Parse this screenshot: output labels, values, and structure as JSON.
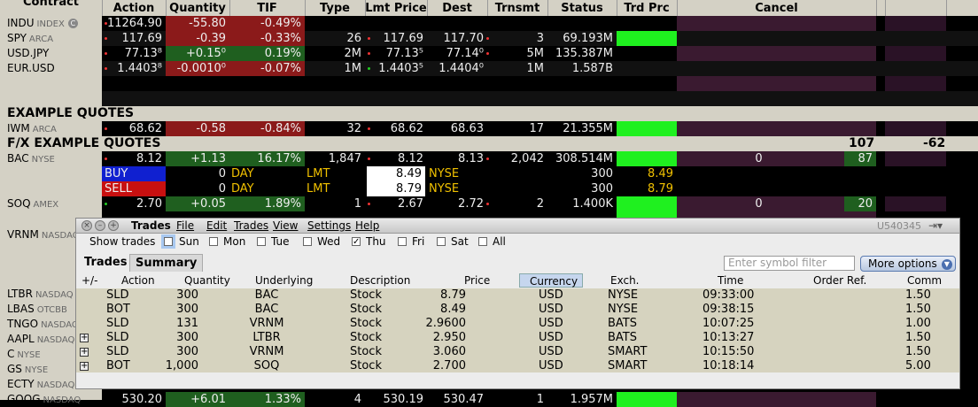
{
  "header": {
    "contract": "Contract",
    "action": "Action",
    "quantity": "Quantity",
    "tif": "TIF",
    "type": "Type",
    "lmt_price": "Lmt Price",
    "dest": "Dest",
    "trnsmt": "Trnsmt",
    "status": "Status",
    "trd_prc": "Trd Prc",
    "cancel": "Cancel"
  },
  "quotes": [
    {
      "sym": "INDU",
      "exch": "INDEX",
      "last": "11264.90",
      "chg": "-55.80",
      "pct": "-0.49%",
      "size": "",
      "bid": "",
      "ask": "",
      "asksize": "",
      "vol": ""
    },
    {
      "sym": "SPY",
      "exch": "ARCA",
      "last": "117.69",
      "chg": "-0.39",
      "pct": "-0.33%",
      "size": "26",
      "bid": "117.69",
      "ask": "117.70",
      "asksize": "3",
      "vol": "69.193M"
    },
    {
      "sym": "USD.JPY",
      "exch": "",
      "last": "77.13⁸",
      "chg": "+0.15⁰",
      "pct": "0.19%",
      "size": "2M",
      "bid": "77.13⁵",
      "ask": "77.14⁰",
      "asksize": "5M",
      "vol": "135.387M"
    },
    {
      "sym": "EUR.USD",
      "exch": "",
      "last": "1.4403⁸",
      "chg": "-0.0010⁰",
      "pct": "-0.07%",
      "size": "1M",
      "bid": "1.4403⁵",
      "ask": "1.4404⁰",
      "asksize": "1M",
      "vol": "1.587B"
    }
  ],
  "section1": "EXAMPLE QUOTES",
  "iwm": {
    "sym": "IWM",
    "exch": "ARCA",
    "last": "68.62",
    "chg": "-0.58",
    "pct": "-0.84%",
    "size": "32",
    "bid": "68.62",
    "ask": "68.63",
    "asksize": "17",
    "vol": "21.355M"
  },
  "section2": {
    "label": "F/X EXAMPLE QUOTES",
    "v1": "107",
    "v2": "-62"
  },
  "bac": {
    "sym": "BAC",
    "exch": "NYSE",
    "last": "8.12",
    "chg": "+1.13",
    "pct": "16.17%",
    "size": "1,847",
    "bid": "8.12",
    "ask": "8.13",
    "asksize": "2,042",
    "vol": "308.514M",
    "c1": "0",
    "c2": "87"
  },
  "buy": {
    "action": "BUY",
    "qty": "0",
    "tif": "DAY",
    "type": "LMT",
    "price": "8.49",
    "dest": "NYSE",
    "trnsmt": "300",
    "trd": "8.49"
  },
  "sell": {
    "action": "SELL",
    "qty": "0",
    "tif": "DAY",
    "type": "LMT",
    "price": "8.79",
    "dest": "NYSE",
    "trnsmt": "300",
    "trd": "8.79"
  },
  "soq": {
    "sym": "SOQ",
    "exch": "AMEX",
    "last": "2.70",
    "chg": "+0.05",
    "pct": "1.89%",
    "size": "1",
    "bid": "2.67",
    "ask": "2.72",
    "asksize": "2",
    "vol": "1.400K",
    "c1": "0",
    "c2": "20"
  },
  "left_syms": [
    {
      "sym": "VRNM",
      "exch": "NASDAQ"
    },
    {
      "sym": "LTBR",
      "exch": "NASDAQ"
    },
    {
      "sym": "LBAS",
      "exch": "OTCBB"
    },
    {
      "sym": "TNGO",
      "exch": "NASDAQ"
    },
    {
      "sym": "AAPL",
      "exch": "NASDAQ"
    },
    {
      "sym": "C",
      "exch": "NYSE"
    },
    {
      "sym": "GS",
      "exch": "NYSE"
    },
    {
      "sym": "ECTY",
      "exch": "NASDAQ"
    },
    {
      "sym": "GOOG",
      "exch": "NASDAQ"
    }
  ],
  "goog": {
    "last": "530.20",
    "chg": "+6.01",
    "pct": "1.33%",
    "size": "4",
    "bid": "530.19",
    "ask": "530.47",
    "asksize": "1",
    "vol": "1.957M"
  },
  "trades_window": {
    "title": "Trades",
    "menu": [
      "File",
      "Edit",
      "Trades",
      "View",
      "Settings",
      "Help"
    ],
    "account": "U540345",
    "show_trades": "Show trades",
    "days": [
      {
        "label": "Sun",
        "checked": false
      },
      {
        "label": "Mon",
        "checked": false
      },
      {
        "label": "Tue",
        "checked": false
      },
      {
        "label": "Wed",
        "checked": false
      },
      {
        "label": "Thu",
        "checked": true
      },
      {
        "label": "Fri",
        "checked": false
      },
      {
        "label": "Sat",
        "checked": false
      },
      {
        "label": "All",
        "checked": false
      }
    ],
    "tabs": [
      "Trades",
      "Summary"
    ],
    "filter_placeholder": "Enter symbol filter",
    "more_options": "More options",
    "columns": [
      "+/-",
      "Action",
      "Quantity",
      "Underlying",
      "Description",
      "Price",
      "Currency",
      "Exch.",
      "Time",
      "Order Ref.",
      "Comm"
    ],
    "rows": [
      {
        "plus": false,
        "action": "SLD",
        "qty": "300",
        "und": "BAC",
        "desc": "Stock",
        "price": "8.79",
        "cur": "USD",
        "exch": "NYSE",
        "time": "09:33:00",
        "ref": "",
        "comm": "1.50"
      },
      {
        "plus": false,
        "action": "BOT",
        "qty": "300",
        "und": "BAC",
        "desc": "Stock",
        "price": "8.49",
        "cur": "USD",
        "exch": "NYSE",
        "time": "09:38:15",
        "ref": "",
        "comm": "1.50"
      },
      {
        "plus": false,
        "action": "SLD",
        "qty": "131",
        "und": "VRNM",
        "desc": "Stock",
        "price": "2.9600",
        "cur": "USD",
        "exch": "BATS",
        "time": "10:07:25",
        "ref": "",
        "comm": "1.00"
      },
      {
        "plus": true,
        "action": "SLD",
        "qty": "300",
        "und": "LTBR",
        "desc": "Stock",
        "price": "2.950",
        "cur": "USD",
        "exch": "BATS",
        "time": "10:13:27",
        "ref": "",
        "comm": "1.50"
      },
      {
        "plus": true,
        "action": "SLD",
        "qty": "300",
        "und": "VRNM",
        "desc": "Stock",
        "price": "3.060",
        "cur": "USD",
        "exch": "SMART",
        "time": "10:15:50",
        "ref": "",
        "comm": "1.50"
      },
      {
        "plus": true,
        "action": "BOT",
        "qty": "1,000",
        "und": "SOQ",
        "desc": "Stock",
        "price": "2.700",
        "cur": "USD",
        "exch": "SMART",
        "time": "10:18:14",
        "ref": "",
        "comm": "5.00"
      }
    ]
  },
  "colors": {
    "red": "#8b1a1a",
    "green": "#1f5f1f",
    "bright_green": "#1ff01f",
    "buy": "#1020d0",
    "sell": "#c81010",
    "trade_row": "#d6d3bf"
  }
}
